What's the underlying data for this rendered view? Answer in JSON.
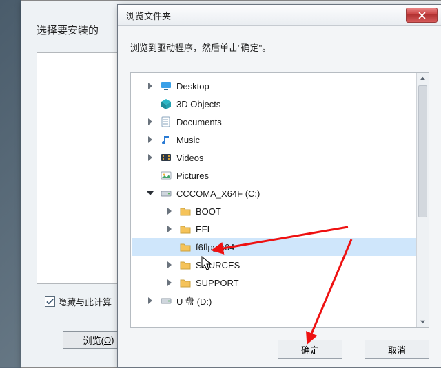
{
  "backwin": {
    "title_partial": "选择要安装的",
    "checkbox_label": "隐藏与此计算",
    "browse_btn_pre": "浏览(",
    "browse_btn_key": "O",
    "browse_btn_post": ")"
  },
  "dlg": {
    "title": "浏览文件夹",
    "instruction": "浏览到驱动程序，然后单击\"确定\"。",
    "ok_label": "确定",
    "cancel_label": "取消"
  },
  "tree": [
    {
      "depth": 1,
      "expander": "collapsed",
      "icon": "desktop",
      "label": "Desktop"
    },
    {
      "depth": 1,
      "expander": "none",
      "icon": "3d",
      "label": "3D Objects"
    },
    {
      "depth": 1,
      "expander": "collapsed",
      "icon": "docs",
      "label": "Documents"
    },
    {
      "depth": 1,
      "expander": "collapsed",
      "icon": "music",
      "label": "Music"
    },
    {
      "depth": 1,
      "expander": "collapsed",
      "icon": "videos",
      "label": "Videos"
    },
    {
      "depth": 1,
      "expander": "none",
      "icon": "pictures",
      "label": "Pictures"
    },
    {
      "depth": 1,
      "expander": "expanded",
      "icon": "drive",
      "label": "CCCOMA_X64F (C:)"
    },
    {
      "depth": 2,
      "expander": "collapsed",
      "icon": "folder",
      "label": "BOOT"
    },
    {
      "depth": 2,
      "expander": "collapsed",
      "icon": "folder",
      "label": "EFI"
    },
    {
      "depth": 2,
      "expander": "none",
      "icon": "folder",
      "label": "f6flpy-x64",
      "selected": true
    },
    {
      "depth": 2,
      "expander": "collapsed",
      "icon": "folder",
      "label": "SOURCES"
    },
    {
      "depth": 2,
      "expander": "collapsed",
      "icon": "folder",
      "label": "SUPPORT"
    },
    {
      "depth": 1,
      "expander": "collapsed",
      "icon": "drive",
      "label": "U 盘 (D:)"
    }
  ]
}
